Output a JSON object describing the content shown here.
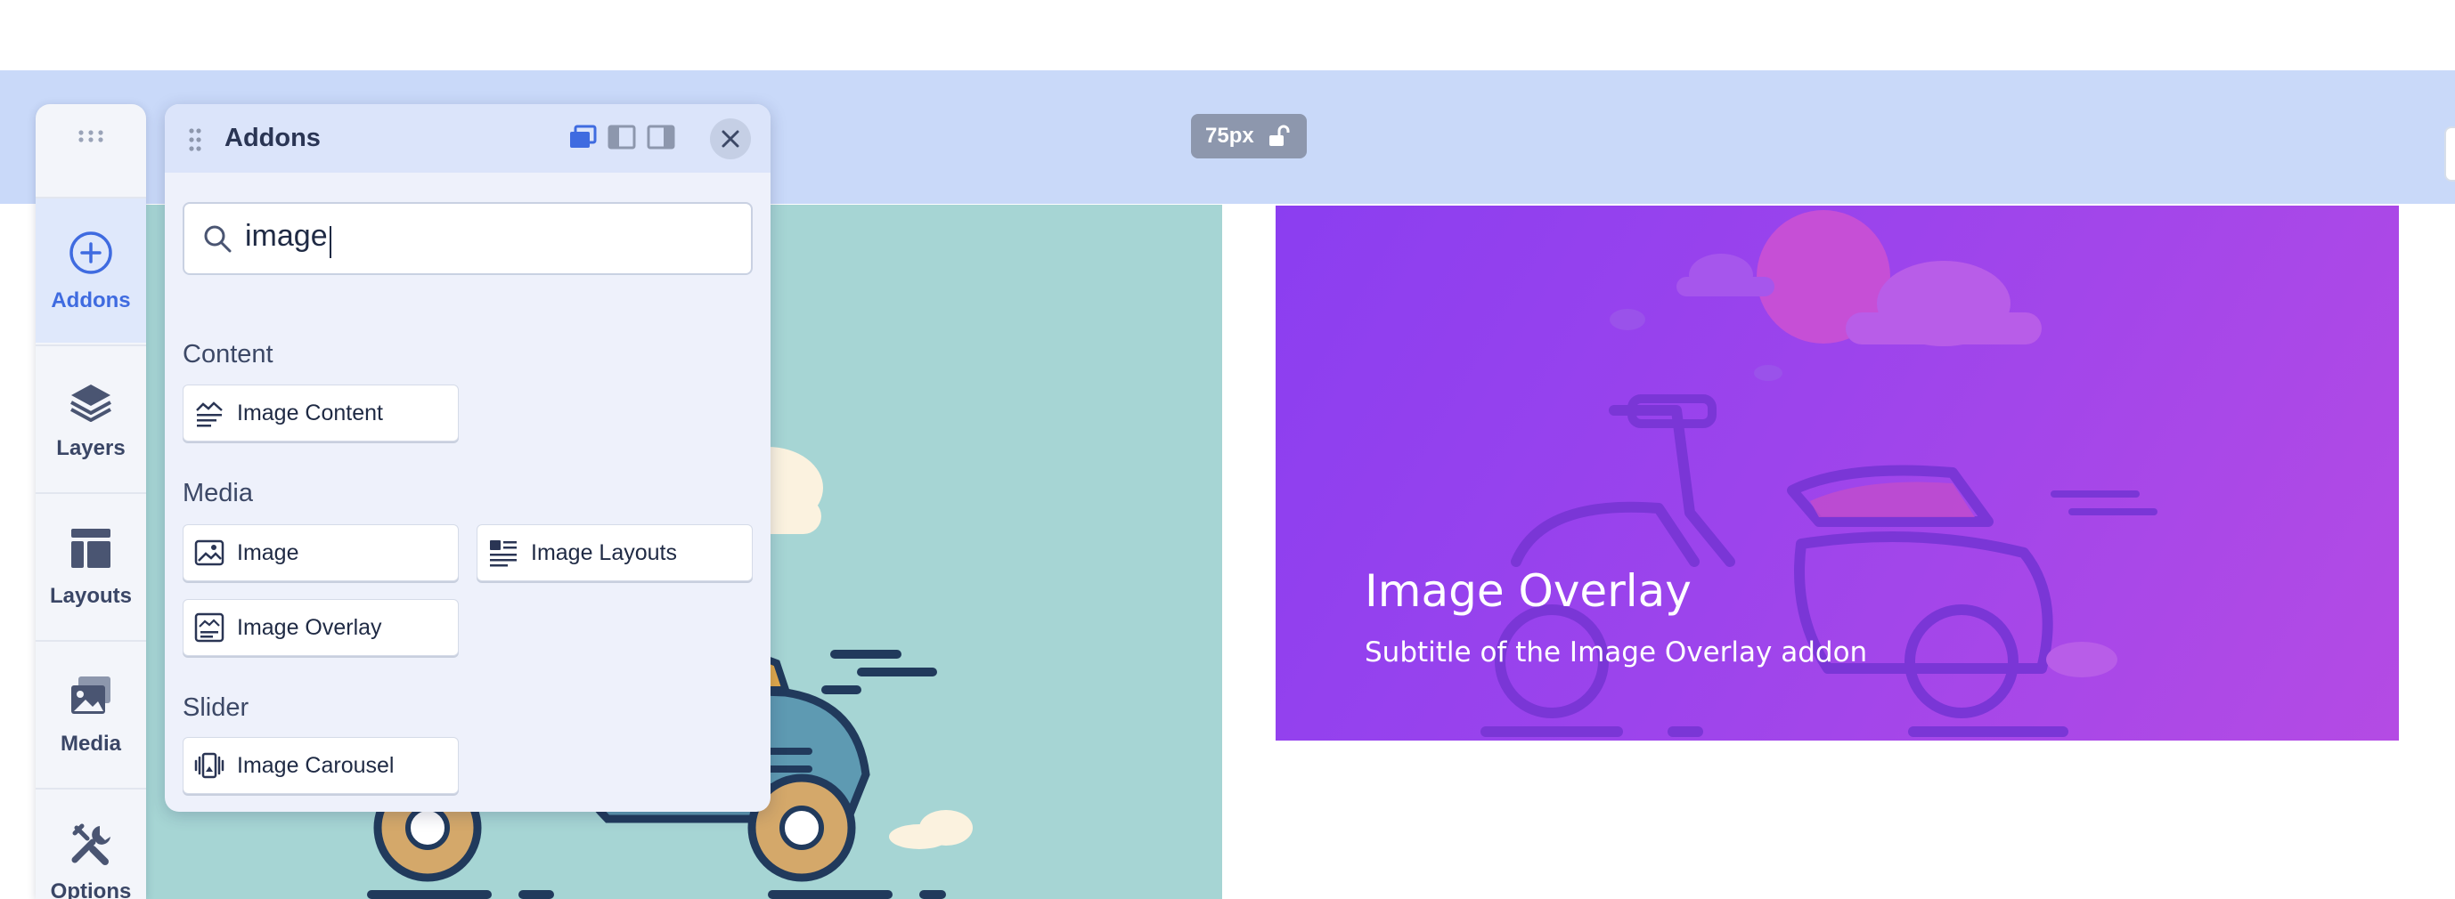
{
  "canvas": {
    "column_size": "75px",
    "overlay": {
      "title": "Image Overlay",
      "subtitle": "Subtitle of the Image Overlay addon"
    }
  },
  "rail": {
    "items": [
      {
        "label": "Addons",
        "icon": "plus-circle-icon",
        "active": true
      },
      {
        "label": "Layers",
        "icon": "layers-icon",
        "active": false
      },
      {
        "label": "Layouts",
        "icon": "layout-icon",
        "active": false
      },
      {
        "label": "Media",
        "icon": "media-icon",
        "active": false
      },
      {
        "label": "Options",
        "icon": "wrench-icon",
        "active": false
      }
    ]
  },
  "panel": {
    "title": "Addons",
    "search": {
      "value": "image"
    },
    "categories": [
      {
        "name": "Content",
        "items": [
          {
            "label": "Image Content",
            "icon": "image-content-icon"
          }
        ]
      },
      {
        "name": "Media",
        "items": [
          {
            "label": "Image",
            "icon": "image-icon"
          },
          {
            "label": "Image Layouts",
            "icon": "image-layouts-icon"
          },
          {
            "label": "Image Overlay",
            "icon": "image-overlay-icon"
          }
        ]
      },
      {
        "name": "Slider",
        "items": [
          {
            "label": "Image Carousel",
            "icon": "image-carousel-icon"
          }
        ]
      }
    ]
  },
  "colors": {
    "accent": "#3f6be0",
    "band": "#c9d9f9",
    "teal_image": "#a6d5d4",
    "purple_image": "#9c44ec"
  }
}
